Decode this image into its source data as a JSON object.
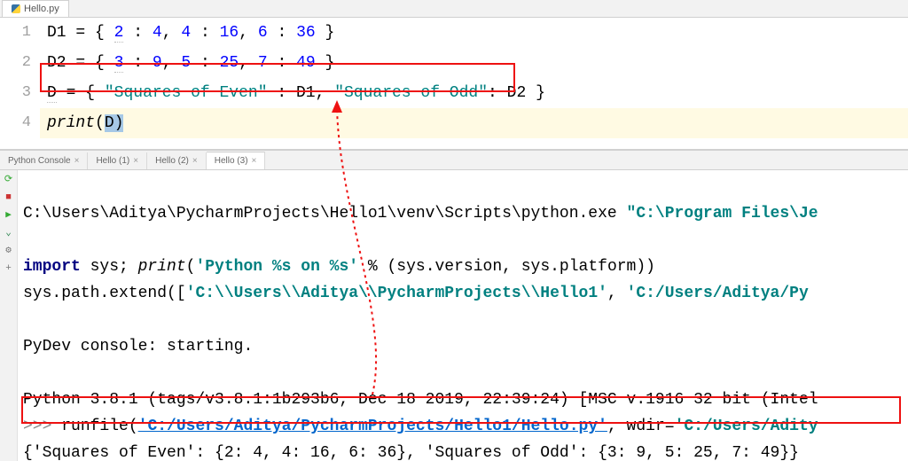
{
  "editor": {
    "tab": "Hello.py",
    "lines": [
      "1",
      "2",
      "3",
      "4"
    ],
    "d1_a": "2",
    "d1_b": "4",
    "d1_c": "4",
    "d1_d": "16",
    "d1_e": "6",
    "d1_f": "36",
    "d2_a": "3",
    "d2_b": "9",
    "d2_c": "5",
    "d2_d": "25",
    "d2_e": "7",
    "d2_f": "49",
    "s1": "\"Squares of Even\"",
    "s2": "\"Squares of Odd\"",
    "printf": "print"
  },
  "ctabs": {
    "t0": "Python Console",
    "t1": "Hello (1)",
    "t2": "Hello (2)",
    "t3": "Hello (3)"
  },
  "console": {
    "l1a": "C:\\Users\\Aditya\\PycharmProjects\\Hello1\\venv\\Scripts\\python.exe ",
    "l1b": "\"C:\\Program Files\\Je",
    "l2a": "import",
    "l2b": " sys; ",
    "l2c": "print",
    "l2d": "(",
    "l2e": "'Python %s on %s'",
    "l2f": " % (sys.version, sys.platform))",
    "l3a": "sys.path.extend([",
    "l3b": "'C:\\\\Users\\\\Aditya\\\\PycharmProjects\\\\Hello1'",
    "l3c": ", ",
    "l3d": "'C:/Users/Aditya/Py",
    "l4": "PyDev console: starting.",
    "l5": "Python 3.8.1 (tags/v3.8.1:1b293b6, Dec 18 2019, 22:39:24) [MSC v.1916 32 bit (Intel",
    "l6a": ">>> ",
    "l6b": "runfile(",
    "l6c": "'C:/Users/Aditya/PycharmProjects/Hello1/Hello.py'",
    "l6d": ", wdir=",
    "l6e": "'C:/Users/Adity",
    "l7": "{'Squares of Even': {2: 4, 4: 16, 6: 36}, 'Squares of Odd': {3: 9, 5: 25, 7: 49}}"
  }
}
